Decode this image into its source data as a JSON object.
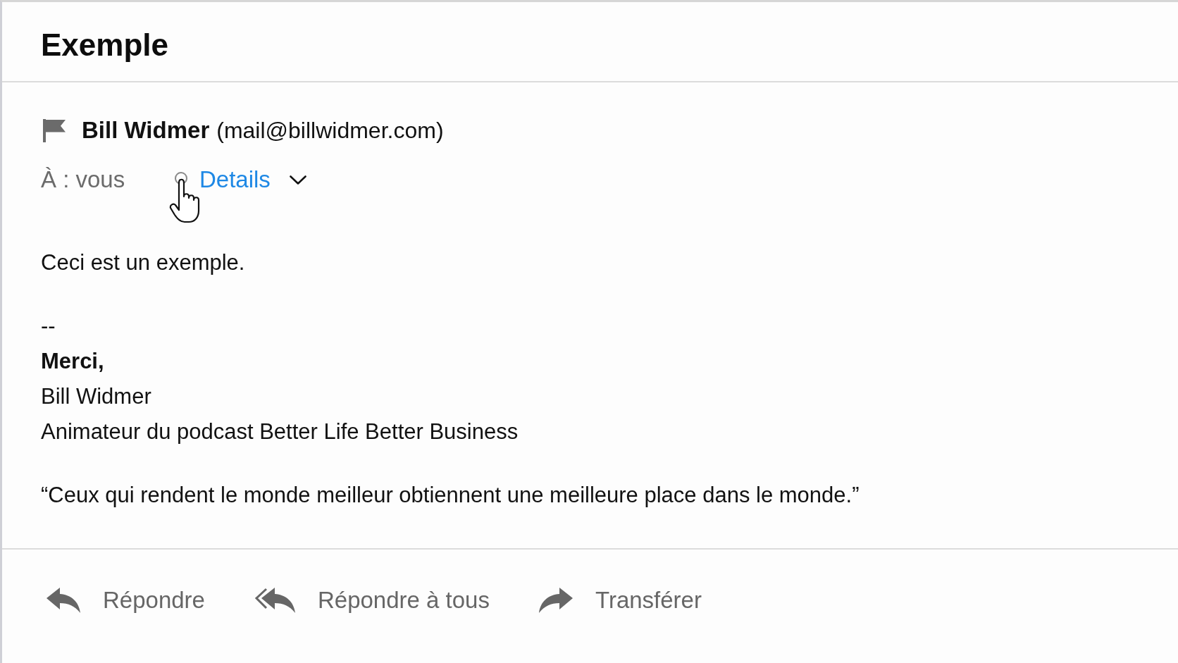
{
  "email": {
    "subject": "Exemple",
    "sender": {
      "name": "Bill Widmer",
      "address": "(mail@billwidmer.com)"
    },
    "recipients": "À : vous",
    "details_link": "Details",
    "body": [
      {
        "lines": [
          {
            "text": "Ceci est un exemple.",
            "bold": false
          }
        ]
      },
      {
        "lines": [
          {
            "text": "--",
            "bold": false
          },
          {
            "text": "Merci,",
            "bold": true
          },
          {
            "text": "Bill Widmer",
            "bold": false
          },
          {
            "text": "Animateur du podcast Better Life Better Business",
            "bold": false
          }
        ]
      },
      {
        "lines": [
          {
            "text": "“Ceux qui rendent le monde meilleur obtiennent une meilleure place dans le monde.”",
            "bold": false
          }
        ]
      }
    ]
  },
  "actions": [
    {
      "kind": "reply",
      "label": "Répondre"
    },
    {
      "kind": "reply_all",
      "label": "Répondre à tous"
    },
    {
      "kind": "forward",
      "label": "Transférer"
    }
  ]
}
